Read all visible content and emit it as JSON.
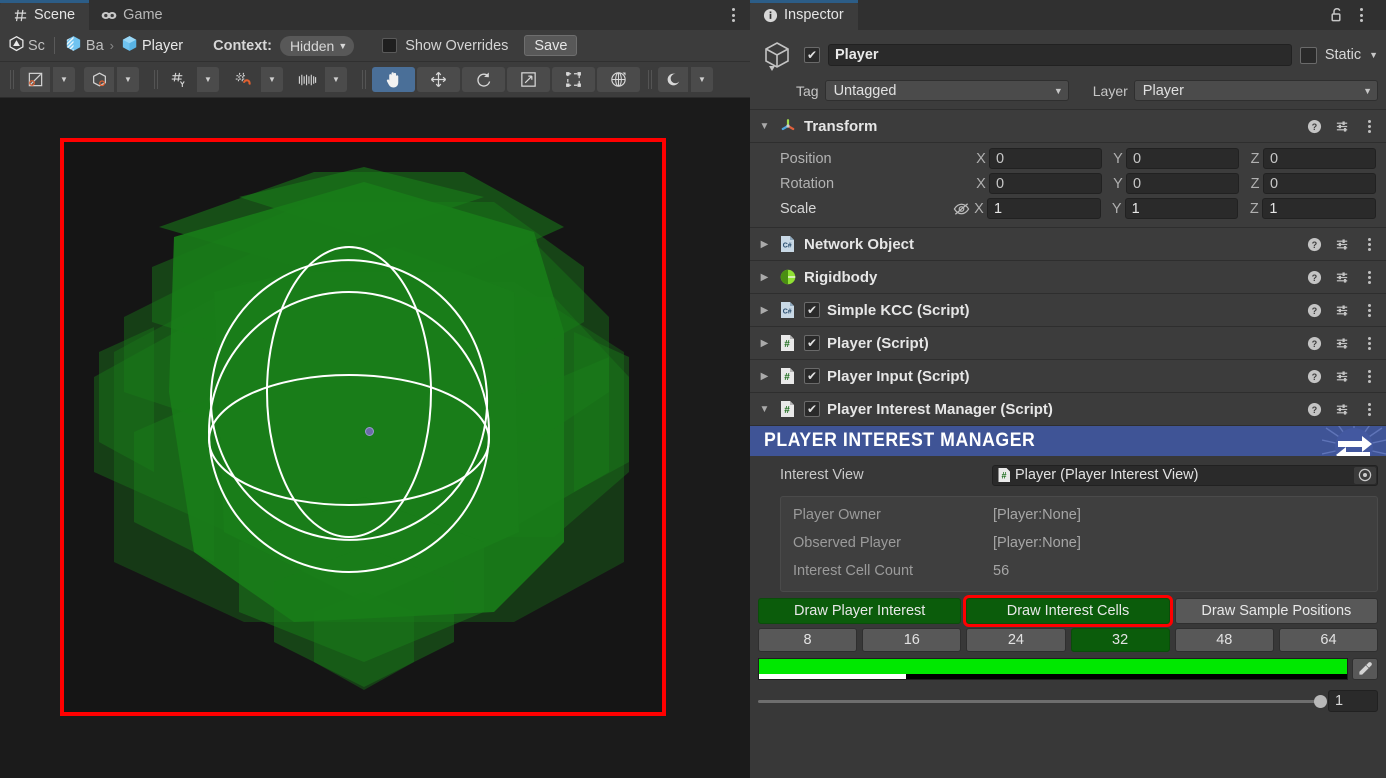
{
  "scene_panel": {
    "tabs": [
      {
        "label": "Scene",
        "icon": "grid-hash-icon",
        "active": true
      },
      {
        "label": "Game",
        "icon": "gamepad-icon",
        "active": false
      }
    ],
    "overflow_menu": "kebab-menu-icon",
    "breadcrumb": {
      "root": "Sc",
      "mid": "Ba",
      "separator": "›",
      "current": "Player"
    },
    "context": {
      "label": "Context:",
      "value": "Hidden",
      "caret": "▼"
    },
    "show_overrides": {
      "label": "Show Overrides",
      "checked": false
    },
    "save_button": "Save",
    "toolbar": [
      {
        "name": "pivot-mode-toggle",
        "icon": "pivot-center-icon",
        "dropdown": true,
        "selected": false
      },
      {
        "name": "handle-orientation-toggle",
        "icon": "cube-local-icon",
        "dropdown": true,
        "selected": false
      },
      {
        "name": "grid-axis-toggle",
        "icon": "grid-y-axis-icon",
        "dropdown": true,
        "selected": false
      },
      {
        "name": "grid-snap-toggle",
        "icon": "grid-magnet-icon",
        "dropdown": true,
        "selected": false
      },
      {
        "name": "increment-snap-toggle",
        "icon": "ruler-icon",
        "dropdown": true,
        "selected": false
      },
      {
        "name": "hand-tool",
        "icon": "hand-icon",
        "dropdown": false,
        "selected": true
      },
      {
        "name": "move-tool",
        "icon": "move-arrows-icon",
        "dropdown": false,
        "selected": false
      },
      {
        "name": "rotate-tool",
        "icon": "rotate-icon",
        "dropdown": false,
        "selected": false
      },
      {
        "name": "scale-tool",
        "icon": "scale-arrow-icon",
        "dropdown": false,
        "selected": false
      },
      {
        "name": "rect-tool",
        "icon": "rect-transform-icon",
        "dropdown": false,
        "selected": false
      },
      {
        "name": "transform-tool",
        "icon": "combined-transform-icon",
        "dropdown": false,
        "selected": false
      },
      {
        "name": "scene-lighting-toggle",
        "icon": "sun-lighting-icon",
        "dropdown": true,
        "selected": false
      }
    ]
  },
  "viewport": {
    "selection_outline_color": "#ff0000",
    "background_color": "#151515",
    "cell_color": "#1fc11f",
    "wire_color": "#ffffff",
    "pivot_color": "#6b6ba8"
  },
  "inspector": {
    "tab": {
      "label": "Inspector",
      "icon": "info-circle-icon"
    },
    "lock_icon": "unlocked-padlock-icon",
    "overflow_menu": "kebab-menu-icon",
    "game_object": {
      "icon": "cube-gameobject-icon",
      "enabled": true,
      "name": "Player",
      "static_label": "Static",
      "static_checked": false,
      "tag_label": "Tag",
      "tag_value": "Untagged",
      "layer_label": "Layer",
      "layer_value": "Player"
    },
    "transform": {
      "title": "Transform",
      "icon": "transform-axis-icon",
      "expanded": true,
      "rows": [
        {
          "label": "Position",
          "x": "0",
          "y": "0",
          "z": "0",
          "dim": true,
          "eye": false
        },
        {
          "label": "Rotation",
          "x": "0",
          "y": "0",
          "z": "0",
          "dim": true,
          "eye": false
        },
        {
          "label": "Scale",
          "x": "1",
          "y": "1",
          "z": "1",
          "dim": false,
          "eye": true
        }
      ],
      "axis_labels": [
        "X",
        "Y",
        "Z"
      ],
      "eye_icon": "eye-off-icon"
    },
    "components": [
      {
        "title": "Network Object",
        "icon": "csharp-script-icon",
        "has_checkbox": false,
        "checked": false,
        "expanded": false
      },
      {
        "title": "Rigidbody",
        "icon": "rigidbody-icon",
        "has_checkbox": false,
        "checked": false,
        "expanded": false
      },
      {
        "title": "Simple KCC (Script)",
        "icon": "csharp-script-icon",
        "has_checkbox": true,
        "checked": true,
        "expanded": false
      },
      {
        "title": "Player (Script)",
        "icon": "hash-script-icon",
        "has_checkbox": true,
        "checked": true,
        "expanded": false
      },
      {
        "title": "Player Input (Script)",
        "icon": "hash-script-icon",
        "has_checkbox": true,
        "checked": true,
        "expanded": false
      },
      {
        "title": "Player Interest Manager (Script)",
        "icon": "hash-script-icon",
        "has_checkbox": true,
        "checked": true,
        "expanded": true
      }
    ],
    "component_tools": {
      "help": "help-question-icon",
      "preset": "preset-sliders-icon",
      "menu": "kebab-menu-icon"
    },
    "player_interest_manager": {
      "banner_title": "PLAYER INTEREST MANAGER",
      "banner_color": "#3f5496",
      "banner_badge_icon": "fusion-arrows-icon",
      "interest_view": {
        "label": "Interest View",
        "value": "Player (Player Interest View)",
        "value_icon": "hash-script-icon",
        "picker_icon": "object-picker-icon"
      },
      "readonly_fields": [
        {
          "label": "Player Owner",
          "value": "[Player:None]"
        },
        {
          "label": "Observed Player",
          "value": "[Player:None]"
        },
        {
          "label": "Interest Cell Count",
          "value": "56"
        }
      ],
      "draw_buttons": [
        {
          "label": "Draw Player Interest",
          "active": true,
          "highlighted": false
        },
        {
          "label": "Draw Interest Cells",
          "active": true,
          "highlighted": true
        },
        {
          "label": "Draw Sample Positions",
          "active": false,
          "highlighted": false
        }
      ],
      "size_buttons": [
        {
          "label": "8",
          "active": false
        },
        {
          "label": "16",
          "active": false
        },
        {
          "label": "24",
          "active": false
        },
        {
          "label": "32",
          "active": true
        },
        {
          "label": "48",
          "active": false
        },
        {
          "label": "64",
          "active": false
        }
      ],
      "color_field": {
        "color": "#00e800",
        "alpha_percent": 25,
        "eyedropper_icon": "eyedropper-icon"
      },
      "slider": {
        "value": "1",
        "percent": 100
      }
    }
  }
}
